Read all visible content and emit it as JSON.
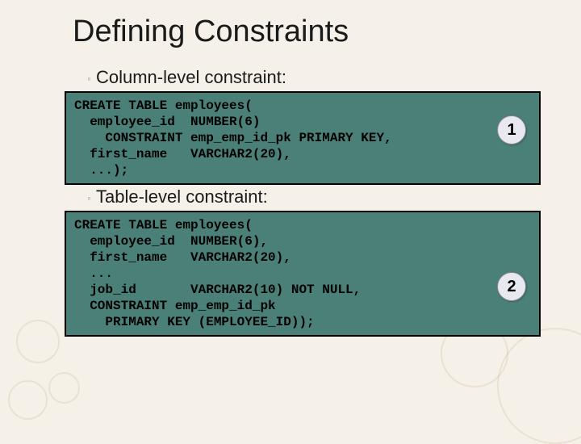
{
  "title": "Defining Constraints",
  "sections": [
    {
      "label": "Column-level constraint:"
    },
    {
      "label": "Table-level constraint:"
    }
  ],
  "code1": {
    "badge": "1",
    "lines": [
      "CREATE TABLE employees(",
      "  employee_id  NUMBER(6)",
      "    CONSTRAINT emp_emp_id_pk PRIMARY KEY,",
      "  first_name   VARCHAR2(20),",
      "  ...);"
    ]
  },
  "code2": {
    "badge": "2",
    "lines": [
      "CREATE TABLE employees(",
      "  employee_id  NUMBER(6),",
      "  first_name   VARCHAR2(20),",
      "  ...",
      "  job_id       VARCHAR2(10) NOT NULL,",
      "  CONSTRAINT emp_emp_id_pk",
      "    PRIMARY KEY (EMPLOYEE_ID));"
    ]
  }
}
